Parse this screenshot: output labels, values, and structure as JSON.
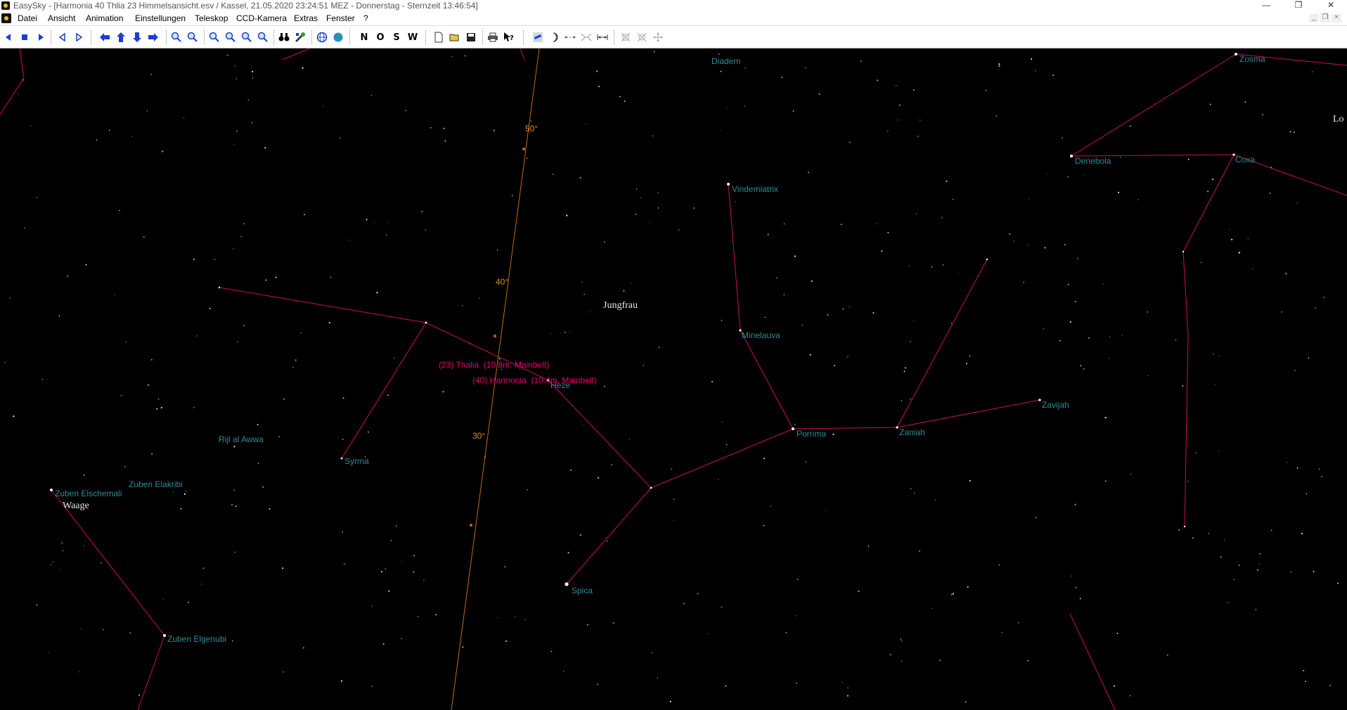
{
  "window": {
    "title": "EasySky - [Harmonia 40 Thlia 23  Himmelsansicht.esv /  Kassel, 21.05.2020 23:24:51 MEZ - Donnerstag - Sternzeit 13:46:54]",
    "minimize": "—",
    "restore": "❐",
    "close": "✕"
  },
  "menu": {
    "items": [
      "Datei",
      "Ansicht",
      "Animation",
      "Einstellungen",
      "Teleskop",
      "CCD-Kamera",
      "Extras",
      "Fenster",
      "?"
    ],
    "mdi_minimize": "_",
    "mdi_restore": "❐",
    "mdi_close": "×"
  },
  "toolbar": {
    "north": "N",
    "east": "O",
    "south": "S",
    "west": "W"
  },
  "colors": {
    "sky_background": "#000000",
    "constellation_line": "#c8105c",
    "star_label": "#2b8c97",
    "ecliptic_line": "#c06a1a",
    "asteroid_label": "#e6006e"
  },
  "sky": {
    "constellations": {
      "virgo": "Jungfrau",
      "libra": "Waage"
    },
    "stars": {
      "diadem": "Diadem",
      "zosma": "Zosma",
      "denebola": "Denebola",
      "coxa": "Coxa",
      "vindemiatrix": "Vindemiatrix",
      "minelauva": "Minelauva",
      "heze": "Heze",
      "porrima": "Porrima",
      "zaniah": "Zaniah",
      "zavijah": "Zavijah",
      "syrma": "Syrma",
      "rijl": "Rijl al Awwa",
      "zuben_elakribi": "Zuben Elakribi",
      "zuben_elschemali": "Zuben Elschemali",
      "spica": "Spica",
      "zuben_elgenubi": "Zuben Elgenubi"
    },
    "edge_label": "Lo",
    "ecliptic_degrees": [
      "50°",
      "40°",
      "30°"
    ],
    "asteroids": [
      "(23) Thalia  (10.8m, Mainbelt)",
      "(40) Harmonia  (10.4m, Mainbelt)"
    ]
  }
}
